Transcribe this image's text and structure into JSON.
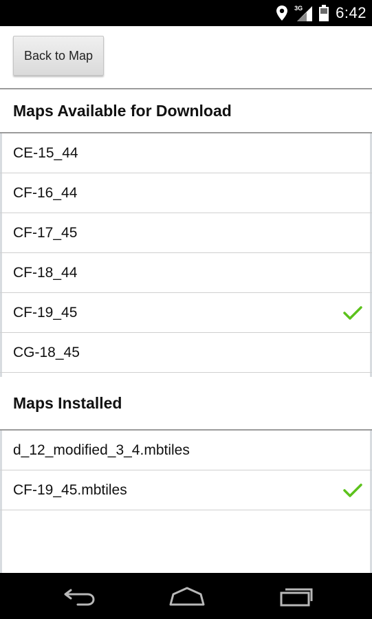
{
  "status_bar": {
    "time": "6:42",
    "network_label": "3G",
    "icons": [
      "location-pin-icon",
      "signal-3g-icon",
      "battery-icon"
    ]
  },
  "toolbar": {
    "back_label": "Back to Map"
  },
  "sections": {
    "available": {
      "title": "Maps Available for Download",
      "items": [
        {
          "label": "CE-15_44",
          "checked": false
        },
        {
          "label": "CF-16_44",
          "checked": false
        },
        {
          "label": "CF-17_45",
          "checked": false
        },
        {
          "label": "CF-18_44",
          "checked": false
        },
        {
          "label": "CF-19_45",
          "checked": true
        },
        {
          "label": "CG-18_45",
          "checked": false
        }
      ]
    },
    "installed": {
      "title": "Maps Installed",
      "items": [
        {
          "label": "d_12_modified_3_4.mbtiles",
          "checked": false
        },
        {
          "label": "CF-19_45.mbtiles",
          "checked": true
        }
      ]
    }
  },
  "navigation": {
    "icons": [
      "back-icon",
      "home-icon",
      "recent-apps-icon"
    ]
  },
  "colors": {
    "check": "#5cc21c",
    "status_bar": "#000000",
    "divider": "#cfcfcf",
    "header_divider": "#9a9a9a"
  }
}
